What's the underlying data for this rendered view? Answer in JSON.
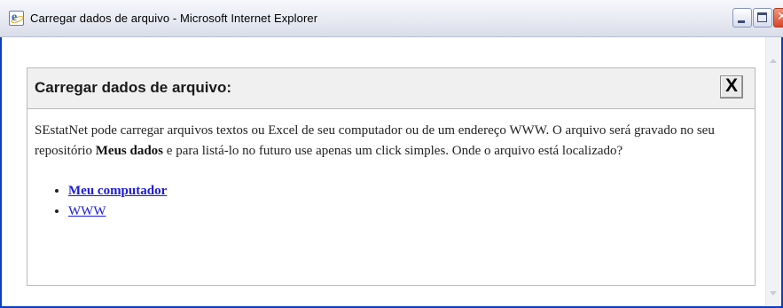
{
  "window": {
    "title": "Carregar dados de arquivo - Microsoft Internet Explorer",
    "icon": "ie-icon",
    "controls": {
      "minimize": "minimize-icon",
      "maximize": "maximize-icon",
      "close_glyph": "✕"
    }
  },
  "dialog": {
    "title": "Carregar dados de arquivo:",
    "close_glyph": "X",
    "text_part1": "SEstatNet pode carregar arquivos textos ou Excel de seu computador ou de um endereço WWW. O arquivo será gravado no seu repositório ",
    "text_bold": "Meus dados",
    "text_part2": " e para listá-lo no futuro use apenas um click simples. Onde o arquivo está localizado?",
    "options": [
      {
        "label": "Meu computador",
        "bold": true
      },
      {
        "label": "WWW",
        "bold": false
      }
    ]
  },
  "colors": {
    "link": "#1a1add",
    "title_bar": "#e6e9f2",
    "window_border": "#0a3fbf",
    "close_button": "#d8452a"
  }
}
